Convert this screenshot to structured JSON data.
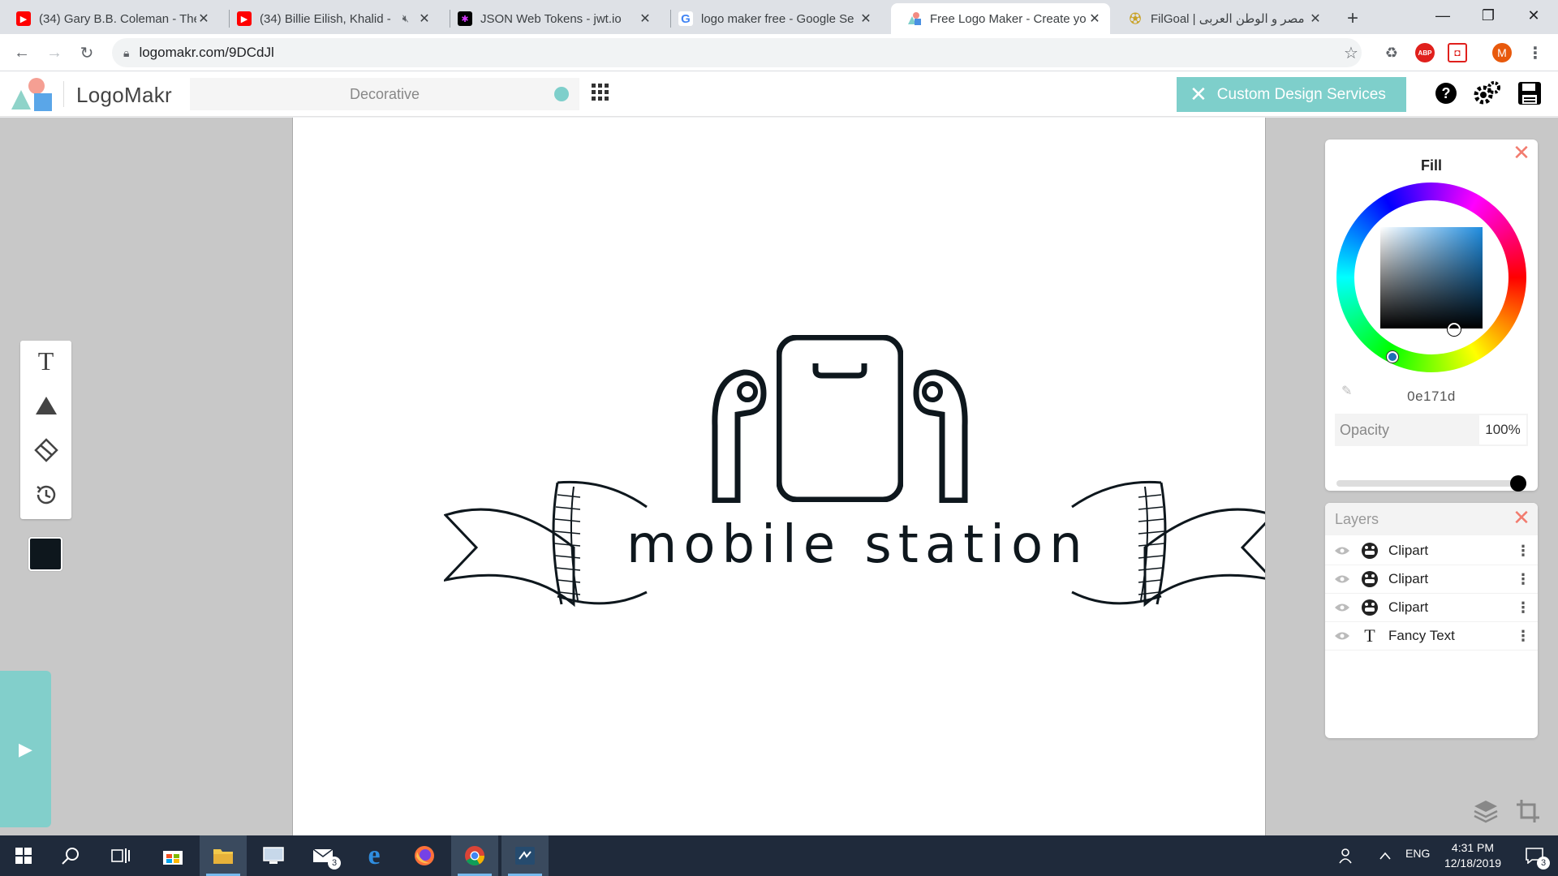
{
  "browser": {
    "tabs": [
      {
        "title": "(34) Gary B.B. Coleman - The",
        "favicon": "youtube-icon",
        "active": false
      },
      {
        "title": "(34) Billie Eilish, Khalid - ",
        "favicon": "youtube-icon",
        "active": false,
        "muted": true
      },
      {
        "title": "JSON Web Tokens - jwt.io",
        "favicon": "jwt-icon",
        "active": false
      },
      {
        "title": "logo maker free - Google Se",
        "favicon": "google-icon",
        "active": false
      },
      {
        "title": "Free Logo Maker - Create yo",
        "favicon": "logomakr-icon",
        "active": true
      },
      {
        "title": "FilGoal | مصر و الوطن العربى",
        "favicon": "filgoal-icon",
        "active": false
      }
    ],
    "url": "logomakr.com/9DCdJl",
    "profile_initial": "M",
    "ext_abp_label": "ABP"
  },
  "app": {
    "brand": "LogoMakr",
    "search_placeholder": "Decorative",
    "cta_label": "Custom Design Services",
    "accent_color": "#7ecfcb"
  },
  "canvas": {
    "logo_text": "mobile station",
    "ink_color": "#0e171d"
  },
  "fill_panel": {
    "title": "Fill",
    "hex": "0e171d",
    "opacity_label": "Opacity",
    "opacity_value": "100%",
    "opacity_fraction": 1.0
  },
  "layers_panel": {
    "title": "Layers",
    "items": [
      {
        "name": "Clipart",
        "type_icon": "clipart-icon"
      },
      {
        "name": "Clipart",
        "type_icon": "clipart-icon"
      },
      {
        "name": "Clipart",
        "type_icon": "clipart-icon"
      },
      {
        "name": "Fancy Text",
        "type_icon": "text-icon"
      }
    ]
  },
  "taskbar": {
    "language": "ENG",
    "time": "4:31 PM",
    "date": "12/18/2019",
    "mail_badge": "3",
    "notification_badge": "3"
  }
}
